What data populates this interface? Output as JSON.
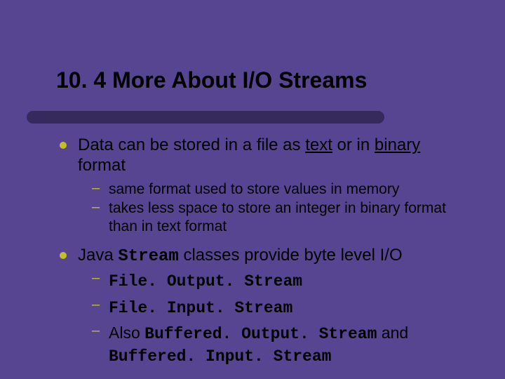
{
  "title": "10. 4 More About I/O Streams",
  "sub_dash": "–",
  "bullets": {
    "b1": {
      "pre": "Data can be stored in a file as ",
      "u1": "text",
      "mid": " or in ",
      "u2": "binary",
      "post": " format",
      "subs": {
        "s1": "same format used to store values in memory",
        "s2": "takes less space to store an integer in binary format than in text format"
      }
    },
    "b2": {
      "pre": "Java ",
      "code": "Stream",
      "post": "  classes provide byte level I/O",
      "subs": {
        "s1": "File. Output. Stream",
        "s2": "File. Input. Stream",
        "s3": {
          "pre": "Also ",
          "c1": "Buffered. Output. Stream",
          "mid": " and ",
          "c2": "Buffered. Input. Stream"
        }
      }
    }
  }
}
